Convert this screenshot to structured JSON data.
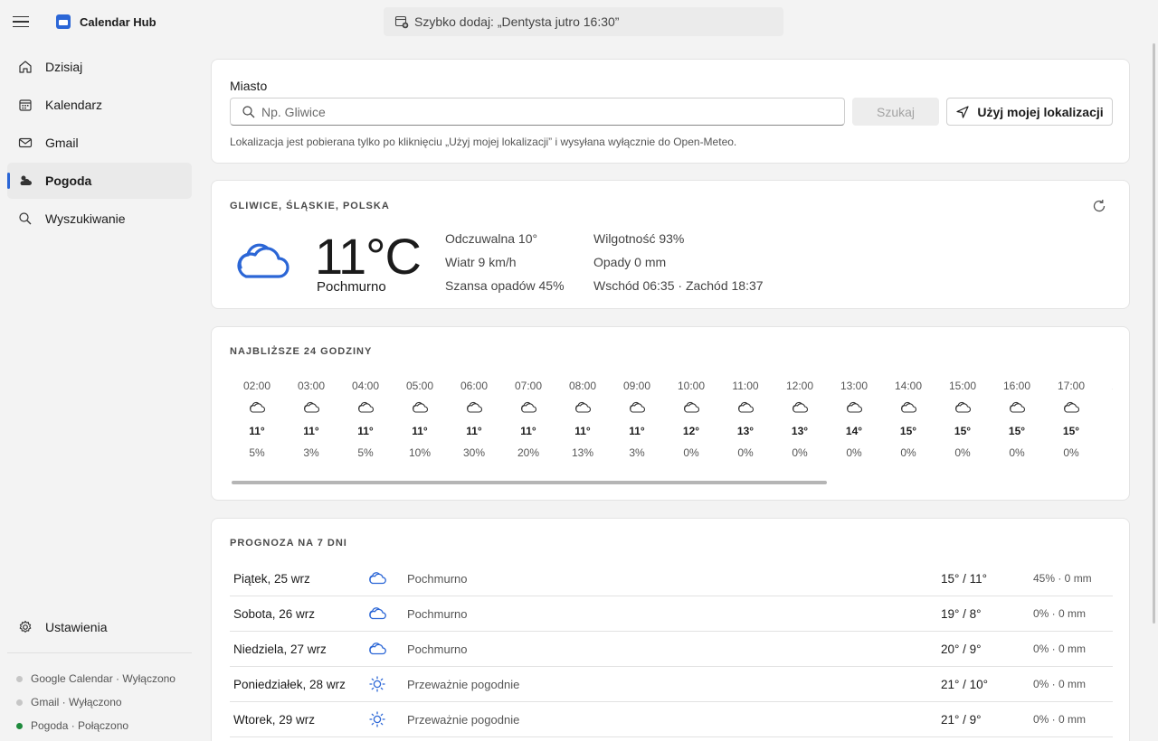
{
  "app": {
    "title": "Calendar Hub"
  },
  "quick_add": {
    "placeholder": "Szybko dodaj: „Dentysta jutro 16:30”"
  },
  "nav": {
    "items": [
      {
        "label": "Dzisiaj",
        "icon": "home-icon"
      },
      {
        "label": "Kalendarz",
        "icon": "calendar-icon"
      },
      {
        "label": "Gmail",
        "icon": "mail-icon"
      },
      {
        "label": "Pogoda",
        "icon": "weather-icon",
        "active": true
      },
      {
        "label": "Wyszukiwanie",
        "icon": "search-icon"
      }
    ],
    "settings": "Ustawienia"
  },
  "status": [
    {
      "label": "Google Calendar · Wyłączono",
      "color": "#c6c6c6"
    },
    {
      "label": "Gmail · Wyłączono",
      "color": "#c6c6c6"
    },
    {
      "label": "Pogoda · Połączono",
      "color": "#1e8a3c"
    }
  ],
  "city": {
    "label": "Miasto",
    "placeholder": "Np. Gliwice",
    "search_button": "Szukaj",
    "location_button": "Użyj mojej lokalizacji",
    "hint": "Lokalizacja jest pobierana tylko po kliknięciu „Użyj mojej lokalizacji” i wysyłana wyłącznie do Open-Meteo."
  },
  "current": {
    "location": "GLIWICE, ŚLĄSKIE, POLSKA",
    "temperature": "11°C",
    "condition": "Pochmurno",
    "feels_like": "Odczuwalna 10°",
    "wind": "Wiatr 9 km/h",
    "precip_chance": "Szansa opadów 45%",
    "humidity": "Wilgotność 93%",
    "precipitation": "Opady 0 mm",
    "sun": "Wschód 06:35 · Zachód 18:37"
  },
  "hourly": {
    "title": "NAJBLIŻSZE 24 GODZINY",
    "hours": [
      {
        "time": "02:00",
        "temp": "11°",
        "precip": "5%"
      },
      {
        "time": "03:00",
        "temp": "11°",
        "precip": "3%"
      },
      {
        "time": "04:00",
        "temp": "11°",
        "precip": "5%"
      },
      {
        "time": "05:00",
        "temp": "11°",
        "precip": "10%"
      },
      {
        "time": "06:00",
        "temp": "11°",
        "precip": "30%"
      },
      {
        "time": "07:00",
        "temp": "11°",
        "precip": "20%"
      },
      {
        "time": "08:00",
        "temp": "11°",
        "precip": "13%"
      },
      {
        "time": "09:00",
        "temp": "11°",
        "precip": "3%"
      },
      {
        "time": "10:00",
        "temp": "12°",
        "precip": "0%"
      },
      {
        "time": "11:00",
        "temp": "13°",
        "precip": "0%"
      },
      {
        "time": "12:00",
        "temp": "13°",
        "precip": "0%"
      },
      {
        "time": "13:00",
        "temp": "14°",
        "precip": "0%"
      },
      {
        "time": "14:00",
        "temp": "15°",
        "precip": "0%"
      },
      {
        "time": "15:00",
        "temp": "15°",
        "precip": "0%"
      },
      {
        "time": "16:00",
        "temp": "15°",
        "precip": "0%"
      },
      {
        "time": "17:00",
        "temp": "15°",
        "precip": "0%"
      },
      {
        "time": "18:00",
        "temp": "",
        "precip": ""
      }
    ]
  },
  "daily": {
    "title": "PROGNOZA NA 7 DNI",
    "days": [
      {
        "day": "Piątek, 25 wrz",
        "icon": "cloud-icon",
        "condition": "Pochmurno",
        "temps": "15° / 11°",
        "precip": "45% · 0 mm"
      },
      {
        "day": "Sobota, 26 wrz",
        "icon": "cloud-icon",
        "condition": "Pochmurno",
        "temps": "19° / 8°",
        "precip": "0% · 0 mm"
      },
      {
        "day": "Niedziela, 27 wrz",
        "icon": "cloud-icon",
        "condition": "Pochmurno",
        "temps": "20° / 9°",
        "precip": "0% · 0 mm"
      },
      {
        "day": "Poniedziałek, 28 wrz",
        "icon": "sun-icon",
        "condition": "Przeważnie pogodnie",
        "temps": "21° / 10°",
        "precip": "0% · 0 mm"
      },
      {
        "day": "Wtorek, 29 wrz",
        "icon": "sun-icon",
        "condition": "Przeważnie pogodnie",
        "temps": "21° / 9°",
        "precip": "0% · 0 mm"
      }
    ]
  },
  "colors": {
    "accent": "#2b66d6",
    "connected": "#1e8a3c",
    "disconnected": "#c6c6c6"
  }
}
